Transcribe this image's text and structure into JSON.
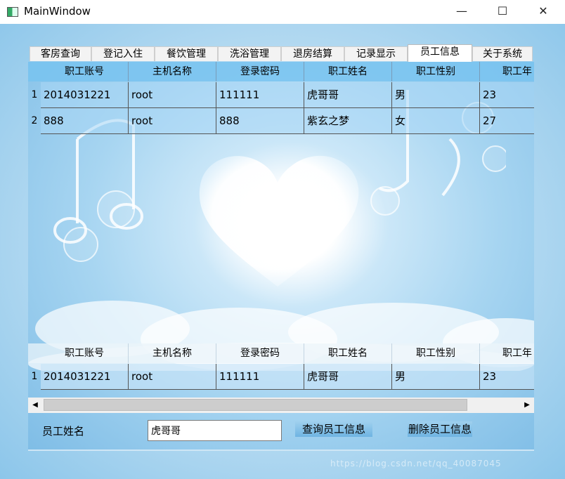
{
  "window": {
    "title": "MainWindow",
    "minimize": "—",
    "maximize": "☐",
    "close": "✕"
  },
  "tabs": [
    "客房查询",
    "登记入住",
    "餐饮管理",
    "洗浴管理",
    "退房结算",
    "记录显示",
    "员工信息",
    "关于系统"
  ],
  "active_tab": "员工信息",
  "columns": [
    "职工账号",
    "主机名称",
    "登录密码",
    "职工姓名",
    "职工性别",
    "职工年"
  ],
  "top_table": {
    "rows": [
      {
        "num": "1",
        "cells": [
          "2014031221",
          "root",
          "111111",
          "虎哥哥",
          "男",
          "23"
        ]
      },
      {
        "num": "2",
        "cells": [
          "888",
          "root",
          "888",
          "紫玄之梦",
          "女",
          "27"
        ]
      }
    ]
  },
  "bottom_table": {
    "rows": [
      {
        "num": "1",
        "cells": [
          "2014031221",
          "root",
          "111111",
          "虎哥哥",
          "男",
          "23"
        ]
      }
    ]
  },
  "scrollbar": {
    "left_arrow": "◀",
    "right_arrow": "▶"
  },
  "form": {
    "label": "员工姓名",
    "name_value": "虎哥哥",
    "query_button": "查询员工信息",
    "delete_button": "删除员工信息"
  },
  "watermark": "https://blog.csdn.net/qq_40087045"
}
